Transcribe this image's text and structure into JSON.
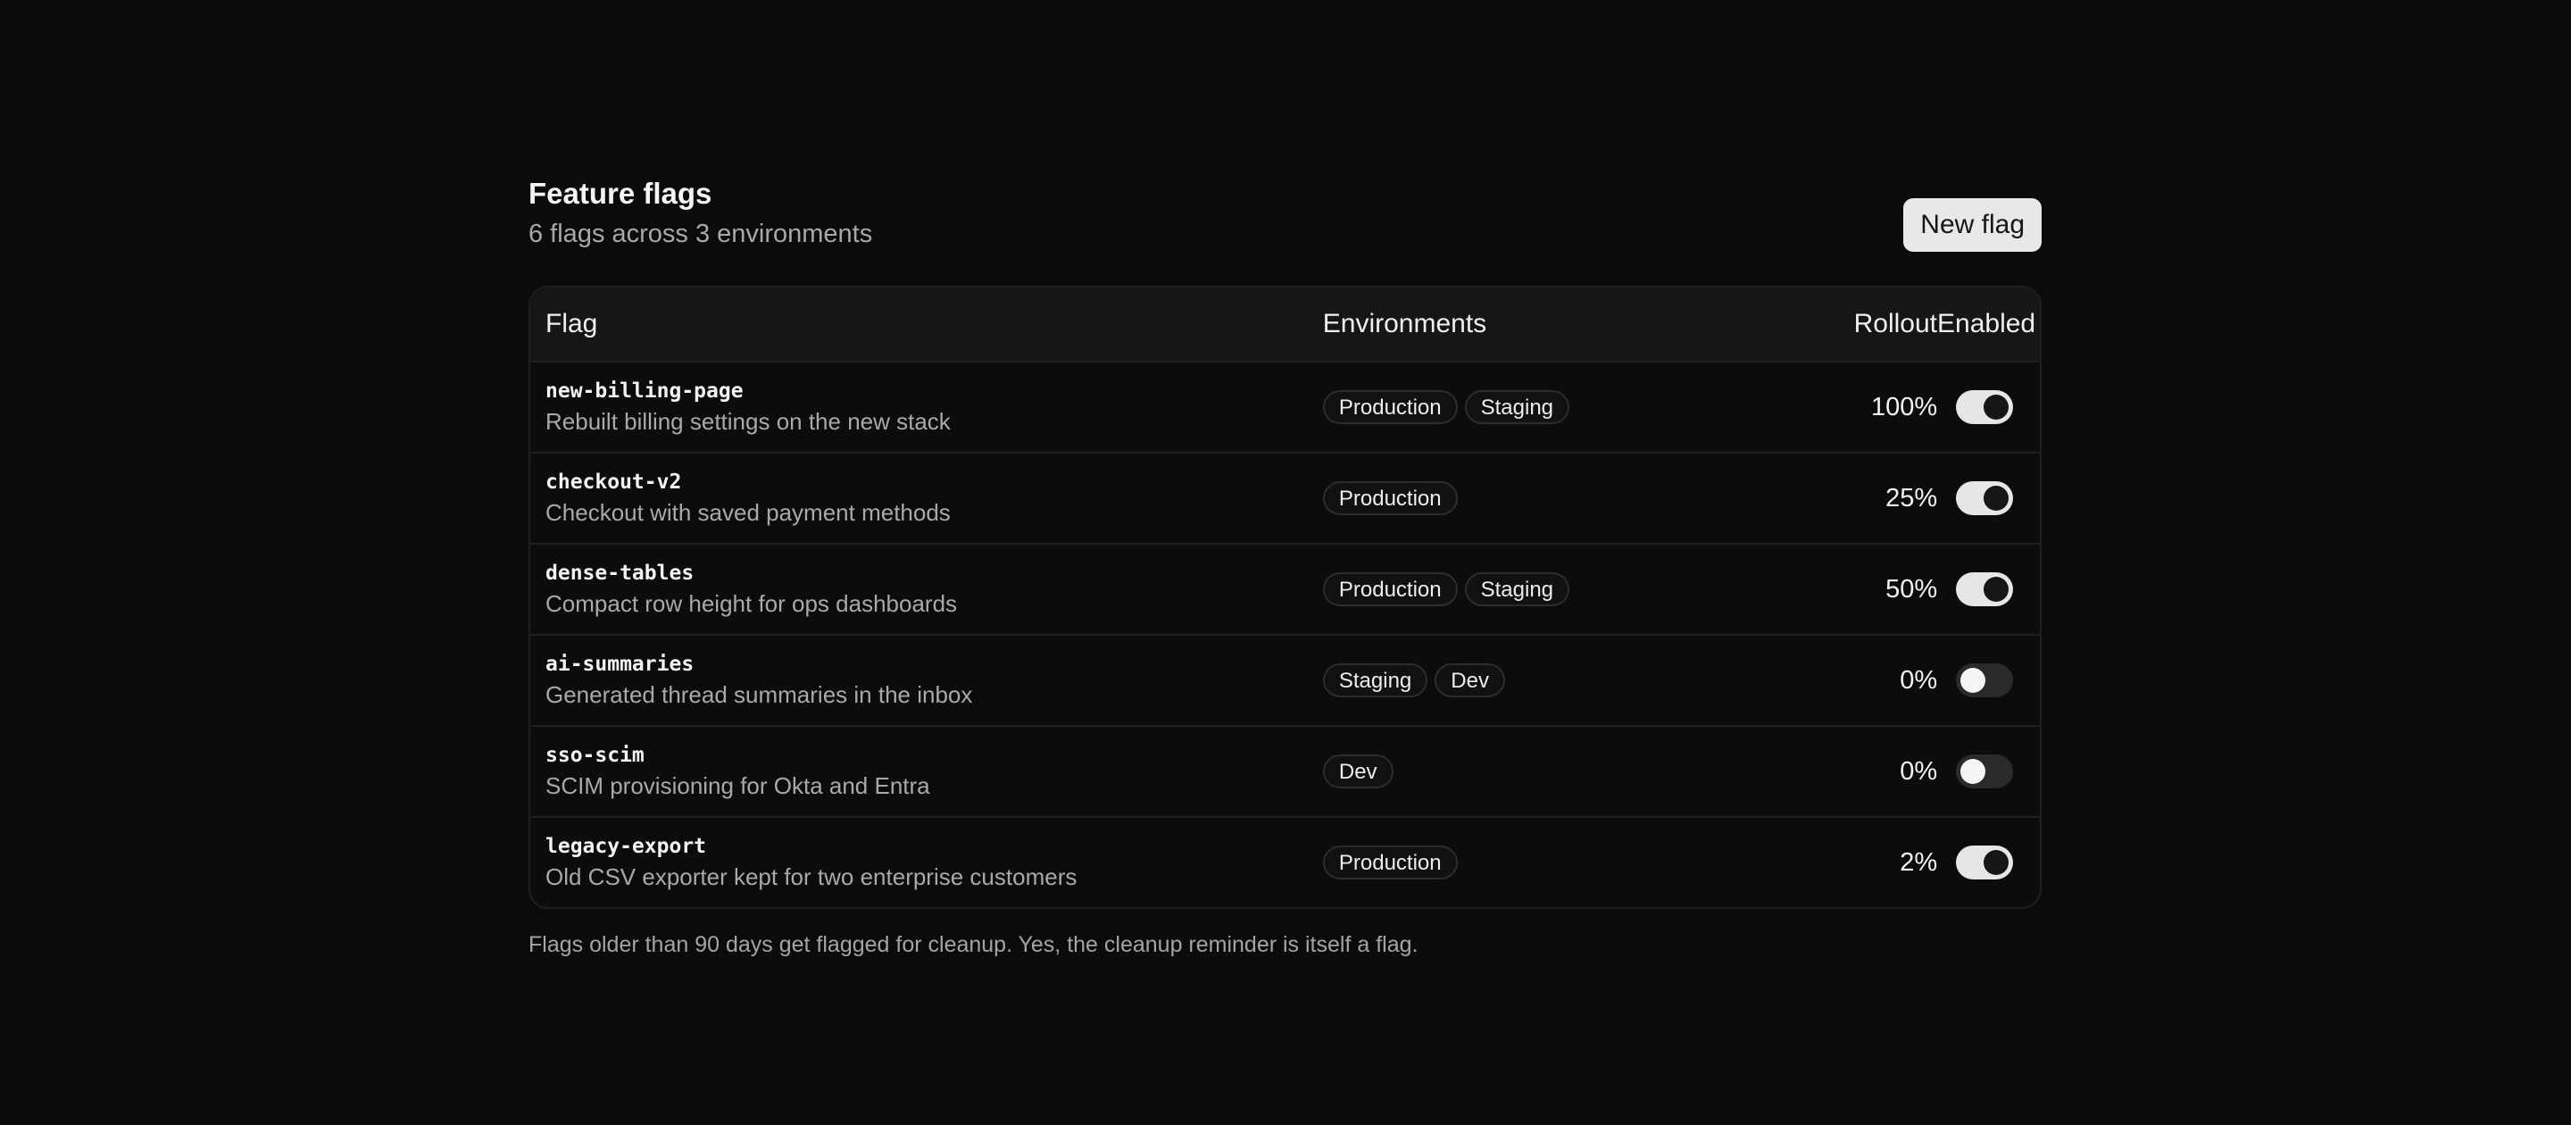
{
  "header": {
    "title": "Feature flags",
    "subtitle": "6 flags across 3 environments",
    "new_button_label": "New flag"
  },
  "table": {
    "columns": {
      "flag": "Flag",
      "environments": "Environments",
      "rollout": "Rollout",
      "enabled": "Enabled"
    },
    "rows": [
      {
        "name": "new-billing-page",
        "description": "Rebuilt billing settings on the new stack",
        "environments": [
          "Production",
          "Staging"
        ],
        "rollout": "100%",
        "enabled": true
      },
      {
        "name": "checkout-v2",
        "description": "Checkout with saved payment methods",
        "environments": [
          "Production"
        ],
        "rollout": "25%",
        "enabled": true
      },
      {
        "name": "dense-tables",
        "description": "Compact row height for ops dashboards",
        "environments": [
          "Production",
          "Staging"
        ],
        "rollout": "50%",
        "enabled": true
      },
      {
        "name": "ai-summaries",
        "description": "Generated thread summaries in the inbox",
        "environments": [
          "Staging",
          "Dev"
        ],
        "rollout": "0%",
        "enabled": false
      },
      {
        "name": "sso-scim",
        "description": "SCIM provisioning for Okta and Entra",
        "environments": [
          "Dev"
        ],
        "rollout": "0%",
        "enabled": false
      },
      {
        "name": "legacy-export",
        "description": "Old CSV exporter kept for two enterprise customers",
        "environments": [
          "Production"
        ],
        "rollout": "2%",
        "enabled": true
      }
    ]
  },
  "footnote": "Flags older than 90 days get flagged for cleanup. Yes, the cleanup reminder is itself a flag."
}
